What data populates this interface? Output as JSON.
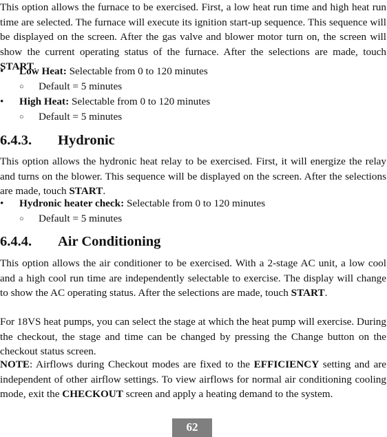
{
  "furnace": {
    "intro_1": "This option allows the furnace to be exercised. First, a low heat run time and high heat run time are selected. The furnace will execute its ignition start-up sequence. This sequence will be displayed on the screen. After the gas valve and blower motor turn on, the screen will show the current operating status of the furnace. After the selections are made, touch ",
    "intro_start": "START",
    "intro_end": ".",
    "items": [
      {
        "bullet": "•",
        "label": "Low Heat:",
        "text": " Selectable from 0 to 120 minutes",
        "sub_bullet": "○",
        "sub_text": "Default = 5 minutes"
      },
      {
        "bullet": "•",
        "label": "High Heat:",
        "text": " Selectable from 0 to 120 minutes",
        "sub_bullet": "○",
        "sub_text": "Default = 5 minutes"
      }
    ]
  },
  "hydronic": {
    "number": "6.4.3.",
    "title": "Hydronic",
    "intro_1": "This option allows the hydronic heat relay to be exercised. First, it will energize the relay and turns on the blower. This sequence will be displayed on the screen. After the selections are made, touch ",
    "intro_start": "START",
    "intro_end": ".",
    "items": [
      {
        "bullet": "•",
        "label": "Hydronic heater check:",
        "text": " Selectable from 0 to 120 minutes",
        "sub_bullet": "○",
        "sub_text": "Default = 5 minutes"
      }
    ]
  },
  "ac": {
    "number": "6.4.4.",
    "title": "Air Conditioning",
    "intro_1": "This option allows the air conditioner to be exercised. With a 2-stage AC unit, a low cool and a high cool run time are independently selectable to exercise. The display will change to show the AC operating status. After the selections are made, touch ",
    "intro_start": "START",
    "intro_end": ".",
    "para_2": "For 18VS heat pumps, you can select the stage at which the heat pump will exercise. During the checkout, the stage and time can be changed by pressing the Change button on the checkout status screen.",
    "note_label": "NOTE",
    "note_1": ":  Airflows during Checkout modes are fixed to the ",
    "note_efficiency": "EFFICIENCY",
    "note_2": " setting and are independent of other airflow settings. To view airflows for normal air conditioning cooling mode, exit the ",
    "note_checkout": "CHECKOUT",
    "note_3": " screen and apply a heating demand to the system."
  },
  "footer": {
    "page_number": "62",
    "page_number_bg": "#7f7f7f"
  }
}
